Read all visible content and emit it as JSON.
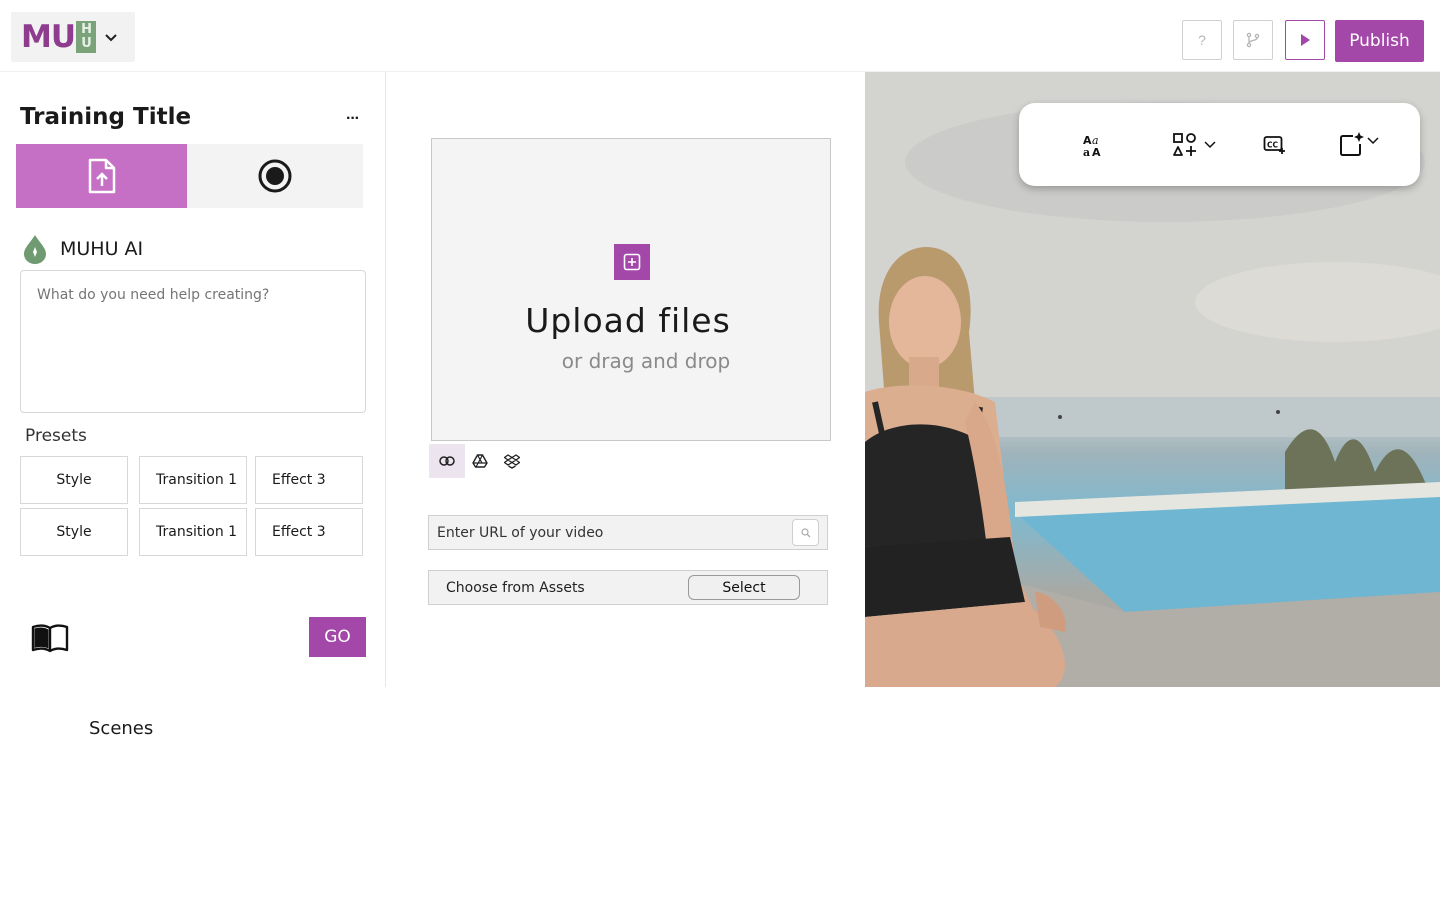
{
  "header": {
    "logo_text": "MU",
    "logo_hu_top": "H",
    "logo_hu_bottom": "U",
    "help_label": "?",
    "publish_label": "Publish"
  },
  "sidebar": {
    "title": "Training Title",
    "more_label": "···",
    "ai_label": "MUHU AI",
    "prompt_placeholder": "What do you need help creating?",
    "presets_label": "Presets",
    "presets": [
      {
        "label": "Style"
      },
      {
        "label": "Transition 1"
      },
      {
        "label": "Effect 3"
      },
      {
        "label": "Style"
      },
      {
        "label": "Transition 1"
      },
      {
        "label": "Effect 3"
      }
    ],
    "go_label": "GO"
  },
  "scenes_label": "Scenes",
  "upload": {
    "title": "Upload files",
    "subtitle": "or drag and drop",
    "url_placeholder": "Enter URL of your video",
    "assets_label": "Choose from Assets",
    "select_label": "Select"
  },
  "colors": {
    "accent": "#a347a8",
    "upload_tab": "#c570c4",
    "logo_green": "#7aa37a"
  }
}
